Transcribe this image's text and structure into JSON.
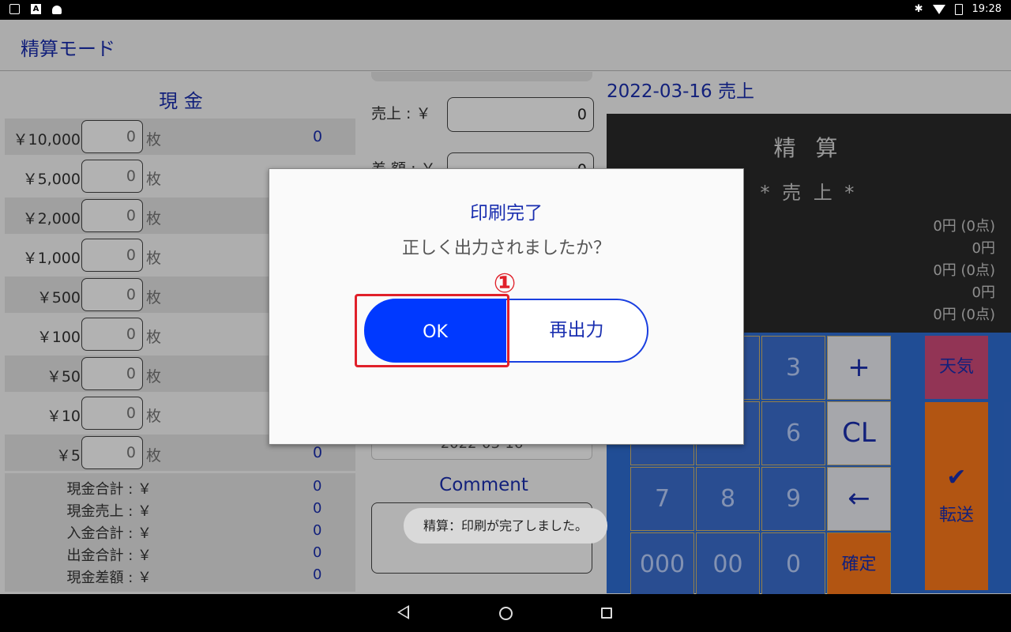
{
  "status_bar": {
    "time": "19:28",
    "icons_left": [
      "image-icon",
      "a-icon",
      "android-icon"
    ],
    "icons_right": [
      "bluetooth-icon",
      "wifi-icon",
      "battery-icon"
    ]
  },
  "app_bar": {
    "title": "精算モード"
  },
  "cash_panel": {
    "title": "現 金",
    "unit": "枚",
    "rows": [
      {
        "denom": "￥10,000",
        "qty": "0",
        "amount": "0"
      },
      {
        "denom": "￥5,000",
        "qty": "0",
        "amount": ""
      },
      {
        "denom": "￥2,000",
        "qty": "0",
        "amount": ""
      },
      {
        "denom": "￥1,000",
        "qty": "0",
        "amount": ""
      },
      {
        "denom": "￥500",
        "qty": "0",
        "amount": ""
      },
      {
        "denom": "￥100",
        "qty": "0",
        "amount": ""
      },
      {
        "denom": "￥50",
        "qty": "0",
        "amount": ""
      },
      {
        "denom": "￥10",
        "qty": "0",
        "amount": ""
      },
      {
        "denom": "￥5",
        "qty": "0",
        "amount": "0"
      }
    ],
    "totals": [
      {
        "label": "現金合計 : ￥",
        "value": "0"
      },
      {
        "label": "現金売上 : ￥",
        "value": "0"
      },
      {
        "label": "入金合計 : ￥",
        "value": "0"
      },
      {
        "label": "出金合計 : ￥",
        "value": "0"
      },
      {
        "label": "現金差額 : ￥",
        "value": "0"
      }
    ]
  },
  "middle_panel": {
    "sales_label": "売上 : ￥",
    "sales_value": "0",
    "diff_label": "差 額 : ￥",
    "diff_value": "0",
    "date_value": "2022-03-16",
    "comment_label": "Comment",
    "comment_value": ""
  },
  "right_panel": {
    "sale_date": "2022-03-16 売上",
    "display_title": "精 算",
    "display_subtitle": "* 売 上 *",
    "display_lines": [
      "0円 (0点)",
      "0円",
      "0円 (0点)",
      "0円",
      "0円 (0点)"
    ],
    "keys": {
      "k3": "3",
      "plus": "+",
      "k6": "6",
      "cl": "CL",
      "k7": "7",
      "k8": "8",
      "k9": "9",
      "back": "←",
      "k000": "000",
      "k00": "00",
      "k0": "0",
      "confirm": "確定"
    },
    "tenki": "天気",
    "tensou_check": "✔",
    "tensou": "転送"
  },
  "dialog": {
    "title": "印刷完了",
    "message": "正しく出力されましたか？",
    "marker": "①",
    "ok_label": "OK",
    "reprint_label": "再出力"
  },
  "toast": {
    "text": "精算：印刷が完了しました。"
  }
}
